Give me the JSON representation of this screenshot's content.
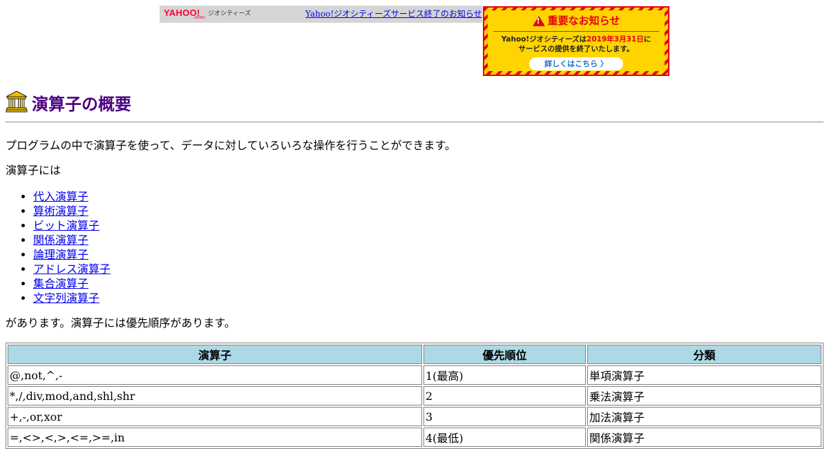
{
  "banner": {
    "logo_text": "YAHOO!",
    "logo_sub": "JAPAN",
    "site_label": "ジオシティーズ",
    "link_text": "Yahoo!ジオシティーズサービス終了のお知らせ"
  },
  "notice": {
    "title": "重要なお知らせ",
    "line1_prefix": "Yahoo!ジオシティーズは",
    "line1_date": "2019年3月31日",
    "line1_suffix": "に",
    "line2": "サービスの提供を終了いたします。",
    "button_label": "詳しくはこちら 〉",
    "colors": {
      "red": "#e60012",
      "yellow": "#ffd400",
      "link_blue": "#1e6ec8"
    }
  },
  "page": {
    "icon": "bank-building-icon",
    "title": "演算子の概要",
    "title_color": "#4b0082",
    "intro": "プログラムの中で演算子を使って、データに対していろいろな操作を行うことができます。",
    "lead": "演算子には",
    "operators": [
      "代入演算子",
      "算術演算子",
      "ビット演算子",
      "関係演算子",
      "論理演算子",
      "アドレス演算子",
      "集合演算子",
      "文字列演算子"
    ],
    "after": "があります。演算子には優先順序があります。"
  },
  "table": {
    "headers": [
      "演算子",
      "優先順位",
      "分類"
    ],
    "header_bg": "#add8e6",
    "rows": [
      [
        "@,not,^,-",
        "1(最高)",
        "単項演算子"
      ],
      [
        "*,/,div,mod,and,shl,shr",
        "2",
        "乗法演算子"
      ],
      [
        "+,-,or,xor",
        "3",
        "加法演算子"
      ],
      [
        "=,<>,<,>,<=,>=,in",
        "4(最低)",
        "関係演算子"
      ]
    ]
  }
}
